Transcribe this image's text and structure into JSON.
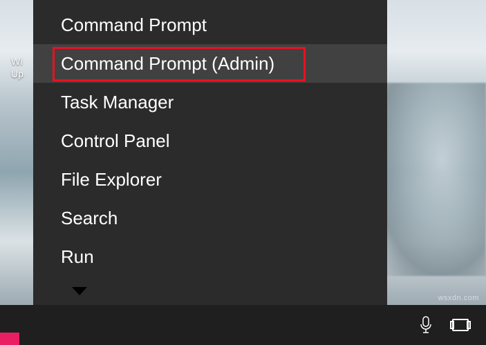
{
  "desktop": {
    "partial_icon_label": "Wi\nUp"
  },
  "context_menu": {
    "items": [
      {
        "label": "Command Prompt",
        "highlighted": false
      },
      {
        "label": "Command Prompt (Admin)",
        "highlighted": true
      },
      {
        "label": "Task Manager",
        "highlighted": false
      },
      {
        "label": "Control Panel",
        "highlighted": false
      },
      {
        "label": "File Explorer",
        "highlighted": false
      },
      {
        "label": "Search",
        "highlighted": false
      },
      {
        "label": "Run",
        "highlighted": false
      }
    ]
  },
  "taskbar": {
    "icons": {
      "mic": "microphone-icon",
      "taskview": "task-view-icon"
    }
  },
  "watermark": "wsxdn.com"
}
